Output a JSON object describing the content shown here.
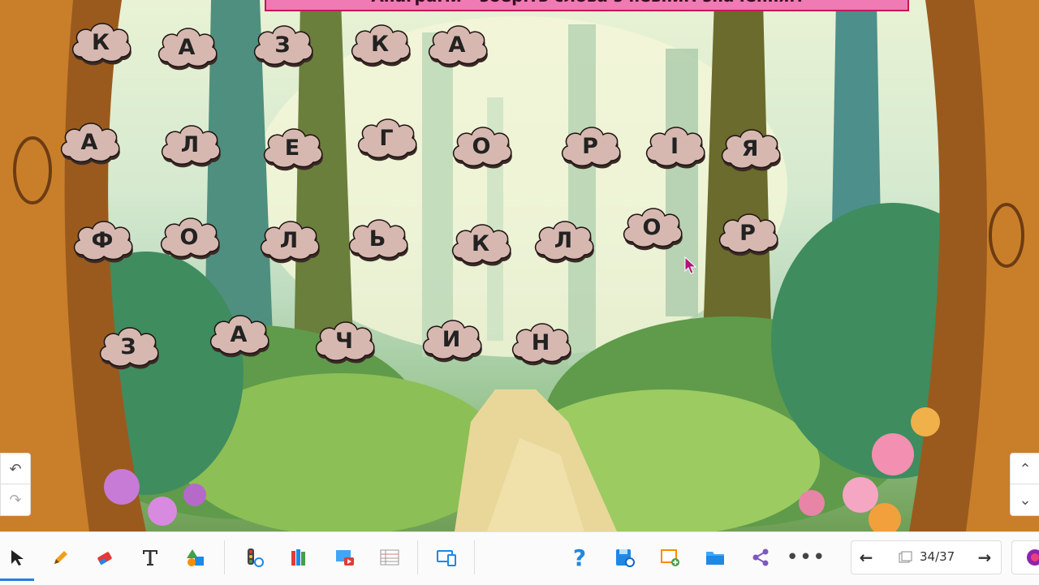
{
  "title_banner": "Анаграми - зберіть слова з певним значенням",
  "letters": [
    "К",
    "А",
    "З",
    "К",
    "А",
    "А",
    "Л",
    "Е",
    "Г",
    "О",
    "Р",
    "І",
    "Я",
    "Ф",
    "О",
    "Л",
    "Ь",
    "К",
    "Л",
    "О",
    "Р",
    "З",
    "А",
    "Ч",
    "И",
    "Н"
  ],
  "pager": {
    "current_total": "34/37"
  },
  "colors": {
    "cloud_fill": "#d7b8b0",
    "cloud_shadow": "#3a2a26",
    "accent": "#2a7de1",
    "banner": "#f07ab3"
  },
  "toolbar": {
    "left_tools": [
      "select-icon",
      "pen-icon",
      "eraser-icon",
      "text-icon",
      "shapes-icon",
      "timer-icon",
      "library-icon",
      "media-icon",
      "table-icon",
      "device-icon"
    ],
    "right_tools": [
      "help-icon",
      "save-icon",
      "add-page-icon",
      "folder-icon",
      "share-icon",
      "more-icon"
    ]
  }
}
